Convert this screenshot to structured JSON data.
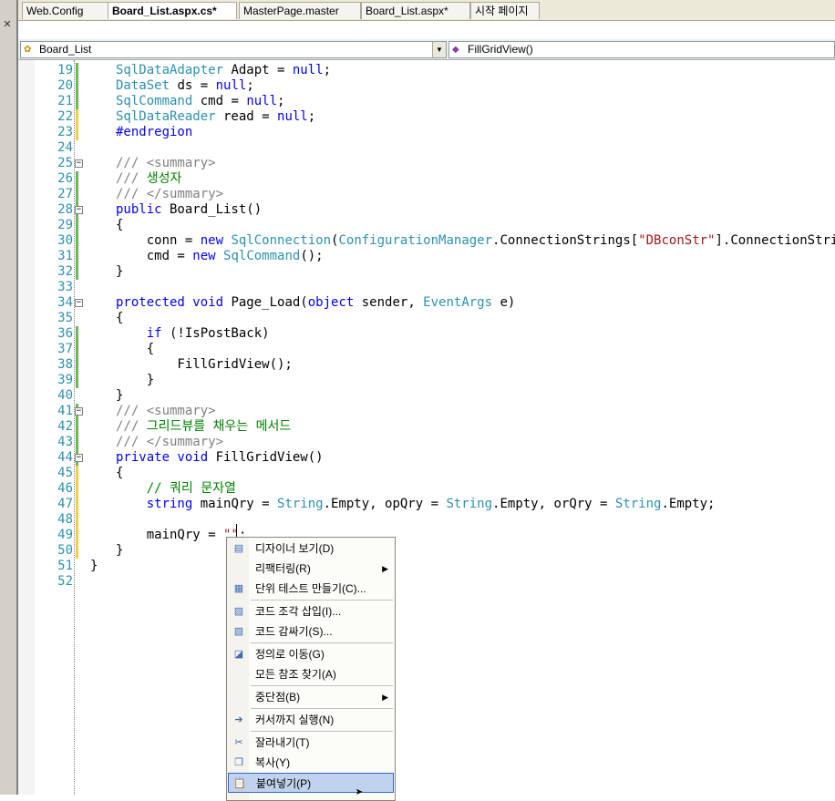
{
  "tabs": [
    {
      "label": "Web.Config",
      "active": false
    },
    {
      "label": "Board_List.aspx.cs*",
      "active": true
    },
    {
      "label": "MasterPage.master",
      "active": false
    },
    {
      "label": "Board_List.aspx*",
      "active": false
    },
    {
      "label": "시작 페이지",
      "active": false
    }
  ],
  "nav": {
    "class_combo": "Board_List",
    "member_combo": "FillGridView()"
  },
  "code_lines": [
    {
      "n": "19",
      "html": "<span class=\"ty\">SqlDataAdapter</span> Adapt = <span class=\"kw\">null</span>;"
    },
    {
      "n": "20",
      "html": "<span class=\"ty\">DataSet</span> ds = <span class=\"kw\">null</span>;"
    },
    {
      "n": "21",
      "html": "<span class=\"ty\">SqlCommand</span> cmd = <span class=\"kw\">null</span>;"
    },
    {
      "n": "22",
      "html": "<span class=\"ty\">SqlDataReader</span> read = <span class=\"kw\">null</span>;"
    },
    {
      "n": "23",
      "html": "<span class=\"kw\">#endregion</span>"
    },
    {
      "n": "24",
      "html": ""
    },
    {
      "n": "25",
      "html": "<span class=\"gr\">/// &lt;summary&gt;</span>"
    },
    {
      "n": "26",
      "html": "<span class=\"gr\">///</span><span class=\"cm\"> 생성자</span>"
    },
    {
      "n": "27",
      "html": "<span class=\"gr\">/// &lt;/summary&gt;</span>"
    },
    {
      "n": "28",
      "html": "<span class=\"kw\">public</span> Board_List()"
    },
    {
      "n": "29",
      "html": "{"
    },
    {
      "n": "30",
      "html": "    conn = <span class=\"kw\">new</span> <span class=\"ty\">SqlConnection</span>(<span class=\"ty\">ConfigurationManager</span>.ConnectionStrings[<span class=\"st\">\"DBconStr\"</span>].ConnectionString);"
    },
    {
      "n": "31",
      "html": "    cmd = <span class=\"kw\">new</span> <span class=\"ty\">SqlCommand</span>();"
    },
    {
      "n": "32",
      "html": "}"
    },
    {
      "n": "33",
      "html": ""
    },
    {
      "n": "34",
      "html": "<span class=\"kw\">protected void</span> Page_Load(<span class=\"kw\">object</span> sender, <span class=\"ty\">EventArgs</span> e)"
    },
    {
      "n": "35",
      "html": "{"
    },
    {
      "n": "36",
      "html": "    <span class=\"kw\">if</span> (!IsPostBack)"
    },
    {
      "n": "37",
      "html": "    {"
    },
    {
      "n": "38",
      "html": "        FillGridView();"
    },
    {
      "n": "39",
      "html": "    }"
    },
    {
      "n": "40",
      "html": "}"
    },
    {
      "n": "41",
      "html": "<span class=\"gr\">/// &lt;summary&gt;</span>"
    },
    {
      "n": "42",
      "html": "<span class=\"gr\">///</span><span class=\"cm\"> 그리드뷰를 채우는 메서드</span>"
    },
    {
      "n": "43",
      "html": "<span class=\"gr\">/// &lt;/summary&gt;</span>"
    },
    {
      "n": "44",
      "html": "<span class=\"kw\">private void</span> FillGridView()"
    },
    {
      "n": "45",
      "html": "{"
    },
    {
      "n": "46",
      "html": "    <span class=\"cm\">// 쿼리 문자열</span>"
    },
    {
      "n": "47",
      "html": "    <span class=\"kw\">string</span> mainQry = <span class=\"ty\">String</span>.Empty, opQry = <span class=\"ty\">String</span>.Empty, orQry = <span class=\"ty\">String</span>.Empty;"
    },
    {
      "n": "48",
      "html": ""
    },
    {
      "n": "49",
      "html": "    mainQry = <span class=\"st\">\"\"</span>;"
    },
    {
      "n": "50",
      "html": "}"
    },
    {
      "n": "51",
      "html": "}"
    },
    {
      "n": "52",
      "html": ""
    }
  ],
  "context_menu": {
    "items": [
      {
        "label": "디자이너 보기(D)",
        "icon": "designer-icon",
        "glyph": "▤",
        "submenu": false
      },
      {
        "label": "리팩터링(R)",
        "icon": "",
        "glyph": "",
        "submenu": true
      },
      {
        "label": "단위 테스트 만들기(C)...",
        "icon": "unit-test-icon",
        "glyph": "▦",
        "submenu": false
      },
      {
        "label": "코드 조각 삽입(I)...",
        "icon": "snippet-insert-icon",
        "glyph": "▧",
        "submenu": false
      },
      {
        "label": "코드 감싸기(S)...",
        "icon": "surround-with-icon",
        "glyph": "▧",
        "submenu": false
      },
      {
        "label": "정의로 이동(G)",
        "icon": "go-to-definition-icon",
        "glyph": "◪",
        "submenu": false
      },
      {
        "label": "모든 참조 찾기(A)",
        "icon": "",
        "glyph": "",
        "submenu": false
      },
      {
        "label": "중단점(B)",
        "icon": "",
        "glyph": "",
        "submenu": true
      },
      {
        "label": "커서까지 실행(N)",
        "icon": "run-to-cursor-icon",
        "glyph": "➔",
        "submenu": false
      },
      {
        "label": "잘라내기(T)",
        "icon": "cut-icon",
        "glyph": "✂",
        "submenu": false
      },
      {
        "label": "복사(Y)",
        "icon": "copy-icon",
        "glyph": "❐",
        "submenu": false
      },
      {
        "label": "붙여넣기(P)",
        "icon": "paste-icon",
        "glyph": "📋",
        "submenu": false
      }
    ]
  }
}
